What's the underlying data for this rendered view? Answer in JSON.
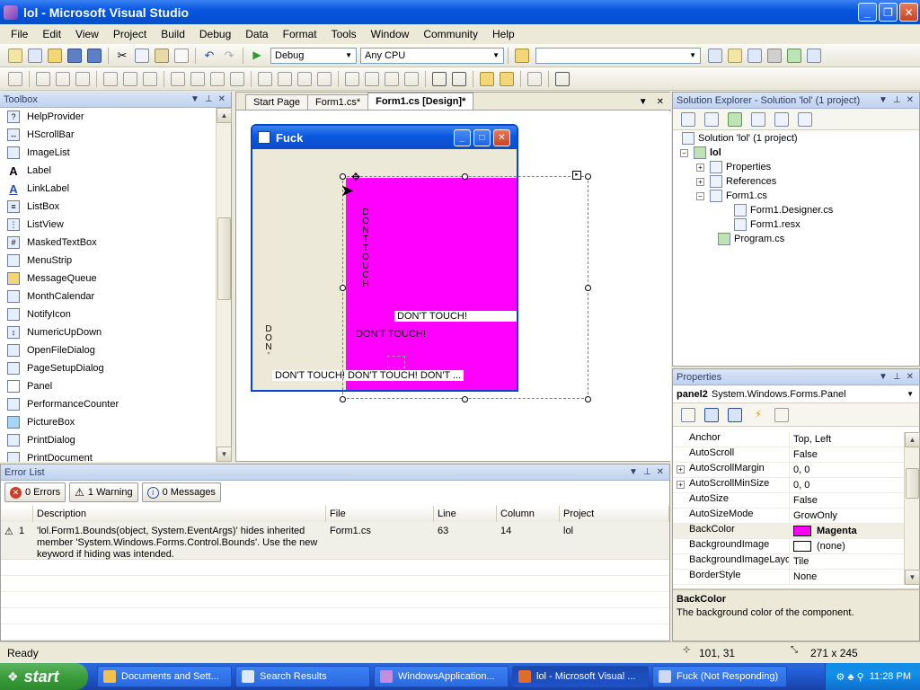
{
  "window": {
    "title": "lol - Microsoft Visual Studio"
  },
  "menu": [
    "File",
    "Edit",
    "View",
    "Project",
    "Build",
    "Debug",
    "Data",
    "Format",
    "Tools",
    "Window",
    "Community",
    "Help"
  ],
  "toolbar": {
    "config": "Debug",
    "platform": "Any CPU"
  },
  "toolbox": {
    "title": "Toolbox",
    "items": [
      "HelpProvider",
      "HScrollBar",
      "ImageList",
      "Label",
      "LinkLabel",
      "ListBox",
      "ListView",
      "MaskedTextBox",
      "MenuStrip",
      "MessageQueue",
      "MonthCalendar",
      "NotifyIcon",
      "NumericUpDown",
      "OpenFileDialog",
      "PageSetupDialog",
      "Panel",
      "PerformanceCounter",
      "PictureBox",
      "PrintDialog",
      "PrintDocument"
    ]
  },
  "doc_tabs": [
    "Start Page",
    "Form1.cs*",
    "Form1.cs [Design]*"
  ],
  "designer": {
    "form_title": "Fuck",
    "vertical_magenta": "DONTTOUCH",
    "vertical_left": "DON'",
    "label_right": "DON'T TOUCH!",
    "label_middle": "DON'T TOUCH!",
    "label_bottom": "DON'T TOUCH!  DON'T TOUCH!  DON'T ..."
  },
  "solution_explorer": {
    "title": "Solution Explorer - Solution 'lol' (1 project)",
    "items": [
      {
        "label": "Solution 'lol' (1 project)",
        "bold": false
      },
      {
        "label": "lol",
        "bold": true
      },
      {
        "label": "Properties",
        "bold": false
      },
      {
        "label": "References",
        "bold": false
      },
      {
        "label": "Form1.cs",
        "bold": false
      },
      {
        "label": "Form1.Designer.cs",
        "bold": false
      },
      {
        "label": "Form1.resx",
        "bold": false
      },
      {
        "label": "Program.cs",
        "bold": false
      }
    ]
  },
  "properties": {
    "title": "Properties",
    "object_name": "panel2",
    "object_type": "System.Windows.Forms.Panel",
    "rows": [
      {
        "name": "Anchor",
        "value": "Top, Left"
      },
      {
        "name": "AutoScroll",
        "value": "False"
      },
      {
        "name": "AutoScrollMargin",
        "value": "0, 0"
      },
      {
        "name": "AutoScrollMinSize",
        "value": "0, 0"
      },
      {
        "name": "AutoSize",
        "value": "False"
      },
      {
        "name": "AutoSizeMode",
        "value": "GrowOnly"
      },
      {
        "name": "BackColor",
        "value": "Magenta"
      },
      {
        "name": "BackgroundImage",
        "value": "(none)"
      },
      {
        "name": "BackgroundImageLayout",
        "value": "Tile"
      },
      {
        "name": "BorderStyle",
        "value": "None"
      }
    ],
    "desc_title": "BackColor",
    "desc_text": "The background color of the component."
  },
  "error_list": {
    "title": "Error List",
    "errors_btn": "0 Errors",
    "warnings_btn": "1 Warning",
    "messages_btn": "0 Messages",
    "columns": [
      "Description",
      "File",
      "Line",
      "Column",
      "Project"
    ],
    "rows": [
      {
        "num": "1",
        "description": "'lol.Form1.Bounds(object, System.EventArgs)' hides inherited member 'System.Windows.Forms.Control.Bounds'. Use the new keyword if hiding was intended.",
        "file": "Form1.cs",
        "line": "63",
        "column": "14",
        "project": "lol"
      }
    ]
  },
  "status": {
    "text": "Ready",
    "position": "101, 31",
    "size": "271 x 245"
  },
  "taskbar": {
    "start": "start",
    "tasks": [
      "Documents and Sett...",
      "Search Results",
      "WindowsApplication...",
      "lol - Microsoft Visual ...",
      "Fuck (Not Responding)"
    ],
    "clock": "11:28 PM"
  },
  "colors": {
    "magenta": "#ff00ff",
    "title_blue": "#0a58e0"
  }
}
